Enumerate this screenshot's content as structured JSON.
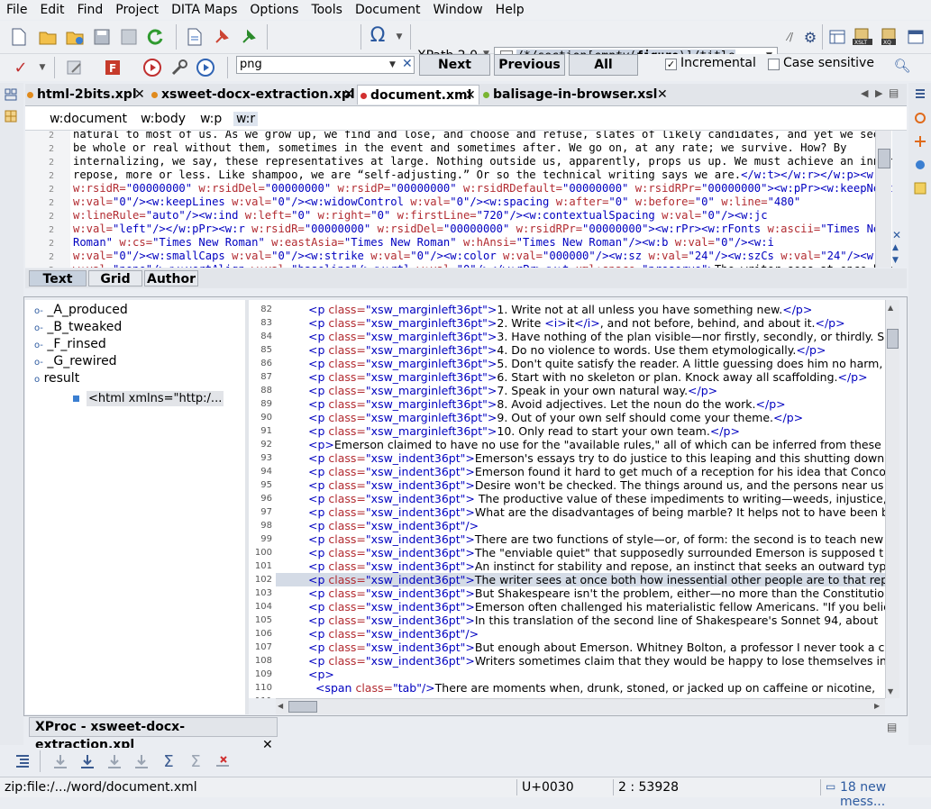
{
  "menu": [
    "File",
    "Edit",
    "Find",
    "Project",
    "DITA Maps",
    "Options",
    "Tools",
    "Document",
    "Window",
    "Help"
  ],
  "toolbar": {
    "xpath_label": "XPath 2.0",
    "xpath_prefix": "/*/section[",
    "xpath_empty": "empty",
    "xpath_open": "(",
    "xpath_figure": "figure",
    "xpath_close": ")]/title"
  },
  "find": {
    "value": "png",
    "next": "Next",
    "previous": "Previous",
    "all": "All",
    "incremental_label": "Incremental",
    "incremental_checked": "✓",
    "case_label": "Case sensitive"
  },
  "tabs": [
    {
      "label": "html-2bits.xpl",
      "color": "#e08a1c"
    },
    {
      "label": "xsweet-docx-extraction.xpl",
      "color": "#e08a1c"
    },
    {
      "label": "document.xml",
      "color": "#d23030"
    },
    {
      "label": "balisage-in-browser.xsl",
      "color": "#7ab532"
    }
  ],
  "breadcrumb": [
    "w:document",
    "w:body",
    "w:p",
    "w:r"
  ],
  "editor_lines": [
    {
      "num": "2",
      "html": "natural to most of us. As we grow up, we find and lose, and choose and refuse, slates of likely candidates, and yet we seem to"
    },
    {
      "num": "2",
      "html": "be whole or real without them, sometimes in the event and sometimes after. We go on, at any rate; we survive. How? By"
    },
    {
      "num": "2",
      "html": "internalizing, we say, these representatives at large. Nothing outside us, apparently, props us up. We must achieve an inner"
    },
    {
      "num": "2",
      "html": "repose, more or less. Like shampoo, we are “self-adjusting.” Or so the technical writing says we are.<span class=tag>&lt;/w:t&gt;&lt;/w:r&gt;&lt;/w:p&gt;&lt;w:p</span>"
    },
    {
      "num": "2",
      "html": "<span class=att>w:rsidR=</span><span class=val>\"00000000\"</span> <span class=att>w:rsidDel=</span><span class=val>\"00000000\"</span> <span class=att>w:rsidP=</span><span class=val>\"00000000\"</span> <span class=att>w:rsidRDefault=</span><span class=val>\"00000000\"</span> <span class=att>w:rsidRPr=</span><span class=val>\"00000000\"</span><span class=tag>&gt;&lt;w:pPr&gt;&lt;w:keepNext</span>"
    },
    {
      "num": "2",
      "html": "<span class=att>w:val=</span><span class=val>\"0\"</span><span class=tag>/&gt;&lt;w:keepLines</span> <span class=att>w:val=</span><span class=val>\"0\"</span><span class=tag>/&gt;&lt;w:widowControl</span> <span class=att>w:val=</span><span class=val>\"0\"</span><span class=tag>/&gt;&lt;w:spacing</span> <span class=att>w:after=</span><span class=val>\"0\"</span> <span class=att>w:before=</span><span class=val>\"0\"</span> <span class=att>w:line=</span><span class=val>\"480\"</span>"
    },
    {
      "num": "2",
      "html": "<span class=att>w:lineRule=</span><span class=val>\"auto\"</span><span class=tag>/&gt;&lt;w:ind</span> <span class=att>w:left=</span><span class=val>\"0\"</span> <span class=att>w:right=</span><span class=val>\"0\"</span> <span class=att>w:firstLine=</span><span class=val>\"720\"</span><span class=tag>/&gt;&lt;w:contextualSpacing</span> <span class=att>w:val=</span><span class=val>\"0\"</span><span class=tag>/&gt;&lt;w:jc</span>"
    },
    {
      "num": "2",
      "html": "<span class=att>w:val=</span><span class=val>\"left\"</span><span class=tag>/&gt;&lt;/w:pPr&gt;&lt;w:r</span> <span class=att>w:rsidR=</span><span class=val>\"00000000\"</span> <span class=att>w:rsidDel=</span><span class=val>\"00000000\"</span> <span class=att>w:rsidRPr=</span><span class=val>\"00000000\"</span><span class=tag>&gt;&lt;w:rPr&gt;&lt;w:rFonts</span> <span class=att>w:ascii=</span><span class=val>\"Times New</span>"
    },
    {
      "num": "2",
      "html": "<span class=val>Roman\"</span> <span class=att>w:cs=</span><span class=val>\"Times New Roman\"</span> <span class=att>w:eastAsia=</span><span class=val>\"Times New Roman\"</span> <span class=att>w:hAnsi=</span><span class=val>\"Times New Roman\"</span><span class=tag>/&gt;&lt;w:b</span> <span class=att>w:val=</span><span class=val>\"0\"</span><span class=tag>/&gt;&lt;w:i</span>"
    },
    {
      "num": "2",
      "html": "<span class=att>w:val=</span><span class=val>\"0\"</span><span class=tag>/&gt;&lt;w:smallCaps</span> <span class=att>w:val=</span><span class=val>\"0\"</span><span class=tag>/&gt;&lt;w:strike</span> <span class=att>w:val=</span><span class=val>\"0\"</span><span class=tag>/&gt;&lt;w:color</span> <span class=att>w:val=</span><span class=val>\"000000\"</span><span class=tag>/&gt;&lt;w:sz</span> <span class=att>w:val=</span><span class=val>\"24\"</span><span class=tag>/&gt;&lt;w:szCs</span> <span class=att>w:val=</span><span class=val>\"24\"</span><span class=tag>/&gt;&lt;w:u</span>"
    },
    {
      "num": "2",
      "html": "<span class=att>w:val=</span><span class=val>\"none\"</span><span class=tag>/&gt;&lt;w:vertAlign</span> <span class=att>w:val=</span><span class=val>\"baseline\"</span><span class=tag>/&gt;&lt;w:rtl</span> <span class=att>w:val=</span><span class=val>\"0\"</span><span class=tag>/&gt;&lt;/w:rPr&gt;&lt;w:t</span> <span class=att>xml:space=</span><span class=val>\"preserve\"</span><span class=tag>&gt;</span>The writer sees at once both"
    }
  ],
  "mode_tabs": [
    "Text",
    "Grid",
    "Author"
  ],
  "tree": {
    "items": [
      "_A_produced",
      "_B_tweaked",
      "_F_rinsed",
      "_G_rewired",
      "result"
    ],
    "child": "<html xmlns=\"http:/..."
  },
  "result_lines": [
    {
      "num": "82",
      "text": "<p class=\"xsw_marginleft36pt\">1. Write not at all unless you have something new.</p>"
    },
    {
      "num": "83",
      "text": "<p class=\"xsw_marginleft36pt\">2. Write <i>it</i>, and not before, behind, and about it.</p>"
    },
    {
      "num": "84",
      "text": "<p class=\"xsw_marginleft36pt\">3. Have nothing of the plan visible—nor firstly, secondly, or thirdly. Sho"
    },
    {
      "num": "85",
      "text": "<p class=\"xsw_marginleft36pt\">4. Do no violence to words. Use them etymologically.</p>"
    },
    {
      "num": "86",
      "text": "<p class=\"xsw_marginleft36pt\">5. Don't quite satisfy the reader. A little guessing does him no harm,"
    },
    {
      "num": "87",
      "text": "<p class=\"xsw_marginleft36pt\">6. Start with no skeleton or plan. Knock away all scaffolding.</p>"
    },
    {
      "num": "88",
      "text": "<p class=\"xsw_marginleft36pt\">7. Speak in your own natural way.</p>"
    },
    {
      "num": "89",
      "text": "<p class=\"xsw_marginleft36pt\">8. Avoid adjectives. Let the noun do the work.</p>"
    },
    {
      "num": "90",
      "text": "<p class=\"xsw_marginleft36pt\">9. Out of your own self should come your theme.</p>"
    },
    {
      "num": "91",
      "text": "<p class=\"xsw_marginleft36pt\">10. Only read to start your own team.</p>"
    },
    {
      "num": "92",
      "text": "<p>Emerson claimed to have no use for the \"available rules,\" all of which can be inferred from these"
    },
    {
      "num": "93",
      "text": "<p class=\"xsw_indent36pt\">Emerson's essays try to do justice to this leaping and this shutting down"
    },
    {
      "num": "94",
      "text": "<p class=\"xsw_indent36pt\">Emerson found it hard to get much of a reception for his idea that Conco"
    },
    {
      "num": "95",
      "text": "<p class=\"xsw_indent36pt\">Desire won't be checked. The things around us, and the persons near us"
    },
    {
      "num": "96",
      "text": "<p class=\"xsw_indent36pt\"> The productive value of these impediments to writing—weeds, injustice, v"
    },
    {
      "num": "97",
      "text": "<p class=\"xsw_indent36pt\">What are the disadvantages of being marble? It helps not to have been b"
    },
    {
      "num": "98",
      "text": "<p class=\"xsw_indent36pt\"/>"
    },
    {
      "num": "99",
      "text": "<p class=\"xsw_indent36pt\">There are two functions of style—or, of form: the second is to teach new"
    },
    {
      "num": "100",
      "text": "<p class=\"xsw_indent36pt\">The \"enviable quiet\" that supposedly surrounded Emerson is supposed t"
    },
    {
      "num": "101",
      "text": "<p class=\"xsw_indent36pt\">An instinct for stability and repose, an instinct that seeks an outward typ"
    },
    {
      "num": "102",
      "text": "<p class=\"xsw_indent36pt\">The writer sees at once both how inessential other people are to that rep"
    },
    {
      "num": "103",
      "text": "<p class=\"xsw_indent36pt\">But Shakespeare isn't the problem, either—no more than the Constitutio"
    },
    {
      "num": "104",
      "text": "<p class=\"xsw_indent36pt\">Emerson often challenged his materialistic fellow Americans. \"If you believ"
    },
    {
      "num": "105",
      "text": "<p class=\"xsw_indent36pt\">In this translation of the second line of Shakespeare's Sonnet 94, about"
    },
    {
      "num": "106",
      "text": "<p class=\"xsw_indent36pt\"/>"
    },
    {
      "num": "107",
      "text": "<p class=\"xsw_indent36pt\">But enough about Emerson. Whitney Bolton, a professor I never took a cl"
    },
    {
      "num": "108",
      "text": "<p class=\"xsw_indent36pt\">Writers sometimes claim that they would be happy to lose themselves in t"
    },
    {
      "num": "109",
      "text": "<p>"
    },
    {
      "num": "110",
      "text": "  <span class=\"tab\"/>There are moments when, drunk, stoned, or jacked up on caffeine or nicotine,"
    },
    {
      "num": "111",
      "text": ""
    }
  ],
  "current_line": "102",
  "xproc_tab": "XProc - xsweet-docx-extraction.xpl",
  "status": {
    "path": "zip:file:/.../word/document.xml",
    "unicode": "U+0030",
    "position": "2 : 53928",
    "messages": "18 new mess..."
  }
}
